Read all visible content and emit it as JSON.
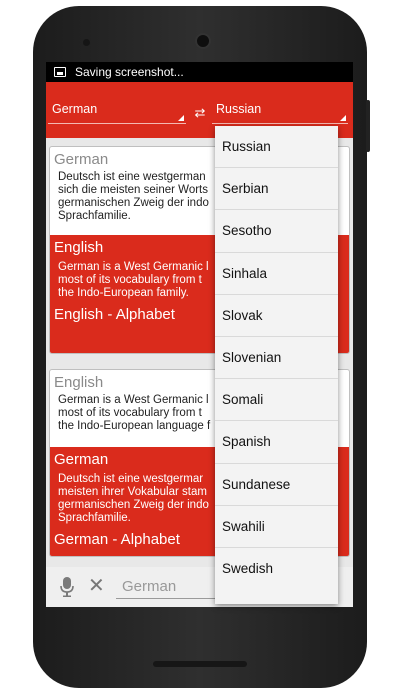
{
  "status_bar": {
    "text": "Saving screenshot..."
  },
  "action_bar": {
    "from_language": "German",
    "to_language": "Russian"
  },
  "card1": {
    "source_language": "German",
    "source_lines": [
      "Deutsch ist eine westgerman",
      "sich die meisten seiner Worts",
      "germanischen Zweig der indo",
      "Sprachfamilie."
    ],
    "target_language": "English",
    "target_lines": [
      "German is a West Germanic l",
      "most of its vocabulary from t",
      "the Indo-European family."
    ],
    "alphabet_label": "English - Alphabet"
  },
  "card2": {
    "source_language": "English",
    "source_lines": [
      "German is a West Germanic l",
      "most of its vocabulary from t",
      "the Indo-European language f"
    ],
    "target_language": "German",
    "target_lines": [
      "Deutsch ist eine westgermar",
      "meisten ihrer Vokabular stam",
      "germanischen Zweig der indo",
      "Sprachfamilie."
    ],
    "alphabet_label": "German - Alphabet"
  },
  "input_bar": {
    "placeholder": "German"
  },
  "dropdown": {
    "options": [
      "Russian",
      "Serbian",
      "Sesotho",
      "Sinhala",
      "Slovak",
      "Slovenian",
      "Somali",
      "Spanish",
      "Sundanese",
      "Swahili",
      "Swedish"
    ]
  },
  "colors": {
    "accent": "#da2b1c",
    "background": "#e8e8e8"
  },
  "icons": {
    "status": "image-icon",
    "swap": "swap-arrows-icon",
    "mic": "microphone-icon",
    "clear": "close-icon"
  }
}
